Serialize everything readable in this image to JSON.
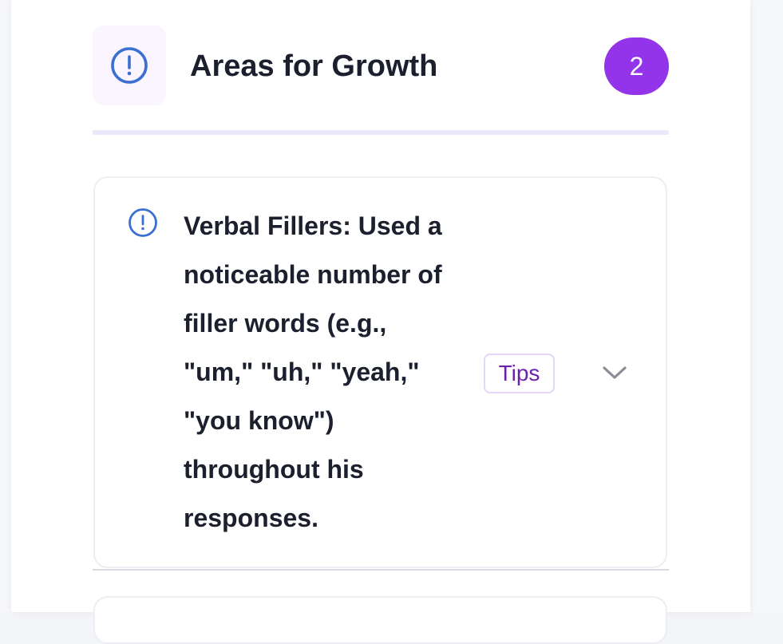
{
  "section": {
    "title": "Areas for Growth",
    "count": "2",
    "icon": "exclamation-circle-icon",
    "accent_color": "#9333ea",
    "icon_color": "#3b6fd1"
  },
  "items": [
    {
      "icon": "exclamation-circle-icon",
      "text": "Verbal Fillers: Used a noticeable number of filler words (e.g., \"um,\" \"uh,\" \"yeah,\" \"you know\") throughout his responses.",
      "tips_label": "Tips",
      "expanded": false
    }
  ]
}
